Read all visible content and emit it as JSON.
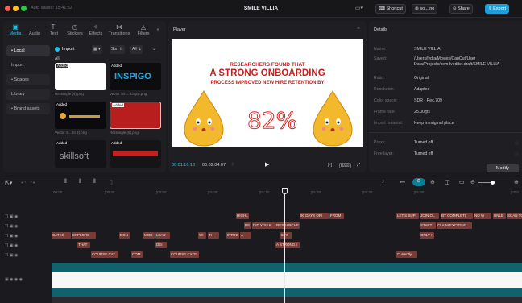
{
  "window": {
    "autosave": "Auto saved: 15:41:53",
    "title": "SMILE VILLIA",
    "shortcut_label": "Shortcut",
    "account_label": "so....no",
    "share_label": "Share",
    "export_label": "Export"
  },
  "media_panel": {
    "tabs": [
      {
        "label": "Media",
        "icon": "media-icon"
      },
      {
        "label": "Audio",
        "icon": "audio-icon"
      },
      {
        "label": "Text",
        "icon": "text-icon"
      },
      {
        "label": "Stickers",
        "icon": "sticker-icon"
      },
      {
        "label": "Effects",
        "icon": "effects-icon"
      },
      {
        "label": "Transitions",
        "icon": "transitions-icon"
      },
      {
        "label": "Filters",
        "icon": "filters-icon"
      }
    ],
    "sidebar": [
      "• Local",
      "Import",
      "• Spaces",
      "Library",
      "• Brand assets"
    ],
    "import_label": "Import",
    "sort_label": "Sort",
    "all_filter_label": "All",
    "all_label": "All",
    "thumbs": [
      {
        "tag": "Added",
        "caption": "Rectangle (4).png"
      },
      {
        "tag": "Added",
        "caption": "Vector Sm...-Logo).png",
        "text": "INSPIGO"
      },
      {
        "tag": "Added",
        "caption": "Vector S....ht 3).png"
      },
      {
        "tag": "Added",
        "caption": "Rectangle (5).png"
      },
      {
        "tag": "Added",
        "caption": "",
        "text": "skillsoft"
      },
      {
        "tag": "Added",
        "caption": ""
      }
    ]
  },
  "player": {
    "title": "Player",
    "line1": "RESEARCHERS FOUND THAT",
    "line2": "A STRONG ONBOARDING",
    "line3": "PROCESS IMPROVED NEW HIRE RETENTION BY",
    "percent": "82%",
    "current_time": "00:01:16:18",
    "total_time": "00:02:04:07",
    "ratio_label": "Ratio"
  },
  "details": {
    "title": "Details",
    "rows": [
      {
        "label": "Name:",
        "value": "SMILE VILLIA"
      },
      {
        "label": "Saved:",
        "value": "/Users/lydia/Movies/CapCut/User Data/Projects/com.lveditor.draft/SMILE VILLIA"
      },
      {
        "label": "Ratio:",
        "value": "Original"
      },
      {
        "label": "Resolution:",
        "value": "Adapted"
      },
      {
        "label": "Color space:",
        "value": "SDR - Rec.709"
      },
      {
        "label": "Frame rate:",
        "value": "25.00fps"
      },
      {
        "label": "Import material:",
        "value": "Keep in original place"
      },
      {
        "label": "Proxy:",
        "value": "Turned off"
      },
      {
        "label": "Free layer:",
        "value": "Turned off"
      }
    ],
    "modify_label": "Modify"
  },
  "timeline": {
    "ruler": [
      "00:00",
      "|00:40",
      "|00:50",
      "|01:00",
      "|01:10",
      "|01:20",
      "|01:30",
      "|01:40",
      "|02:0"
    ],
    "clips_row1": [
      "HIGHL",
      "90 DAYS ORI",
      "FROM",
      "LET'S SUP",
      "JOIN OL",
      "BY COMPLETI",
      "NO W",
      "UNLE",
      "SCAN TO"
    ],
    "clips_row2": [
      "RE",
      "DID YOU K",
      "RESEARCHE",
      "START",
      "CLAIM EXCITING"
    ],
    "clips_row3": [
      "CATES",
      "EXPLORE",
      "DON",
      "MOR",
      "LEAD",
      "WI",
      "TH",
      "INTRO",
      "A",
      "82%",
      "ONLY K"
    ],
    "clips_row4": [
      "THAT",
      "DEI",
      "A STRONG I"
    ],
    "clips_row5": [
      "COURSE CAT",
      "COM",
      "COURSE CATE",
      "Currently"
    ]
  },
  "colors": {
    "accent": "#22c5e8",
    "clip": "#7a3a35",
    "headline": "#c81e1e",
    "export": "#1f9fd6"
  }
}
